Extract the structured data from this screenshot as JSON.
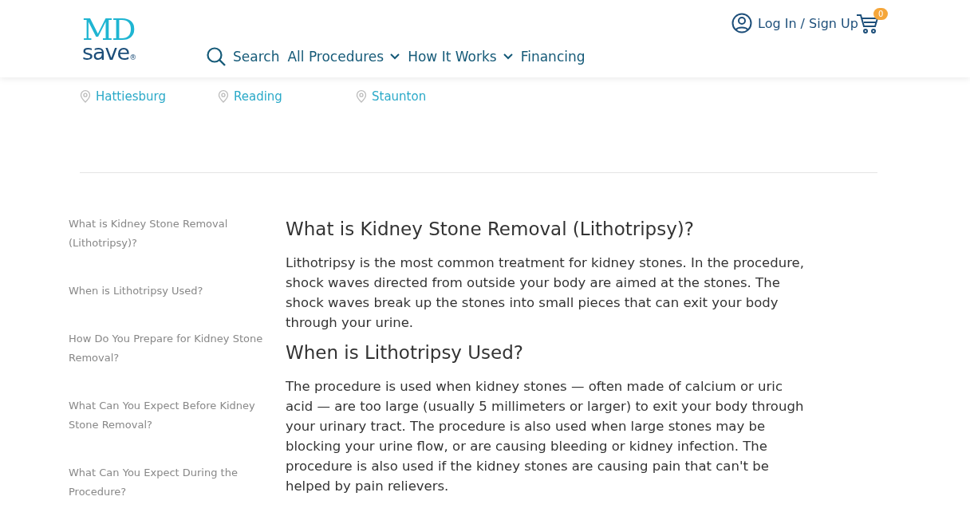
{
  "header": {
    "logo_top": "MD",
    "logo_bottom": "save",
    "logo_mark": "®",
    "nav": [
      {
        "label": "Search",
        "kind": "search"
      },
      {
        "label": "All Procedures",
        "kind": "dropdown"
      },
      {
        "label": "How It Works",
        "kind": "dropdown"
      },
      {
        "label": "Financing",
        "kind": "link"
      }
    ],
    "login": "Log In / Sign Up",
    "cart_count": "0"
  },
  "locations": [
    {
      "city": "Hattiesburg"
    },
    {
      "city": "Reading"
    },
    {
      "city": "Staunton"
    }
  ],
  "toc": [
    "What is Kidney Stone Removal (Lithotripsy)?",
    "When is Lithotripsy Used?",
    "How Do You Prepare for Kidney Stone Removal?",
    "What Can You Expect Before Kidney Stone Removal?",
    "What Can You Expect During the Procedure?"
  ],
  "article": [
    {
      "kind": "heading",
      "text": "What is Kidney Stone Removal (Lithotripsy)?"
    },
    {
      "kind": "paragraph",
      "text": "Lithotripsy is the most common treatment for kidney stones. In the procedure, shock waves directed from outside your body are aimed at the stones. The shock waves break up the stones into small pieces that can exit your body through your urine."
    },
    {
      "kind": "heading",
      "text": "When is Lithotripsy Used?"
    },
    {
      "kind": "paragraph",
      "text": "The procedure is used when kidney stones — often made of calcium or uric acid — are too large (usually 5 millimeters or larger) to exit your body through your urinary tract. The procedure is also used when large stones may be blocking your urine flow, or are causing bleeding or kidney infection. The procedure is also used if the kidney stones are causing pain that can't be helped by pain relievers."
    }
  ]
}
